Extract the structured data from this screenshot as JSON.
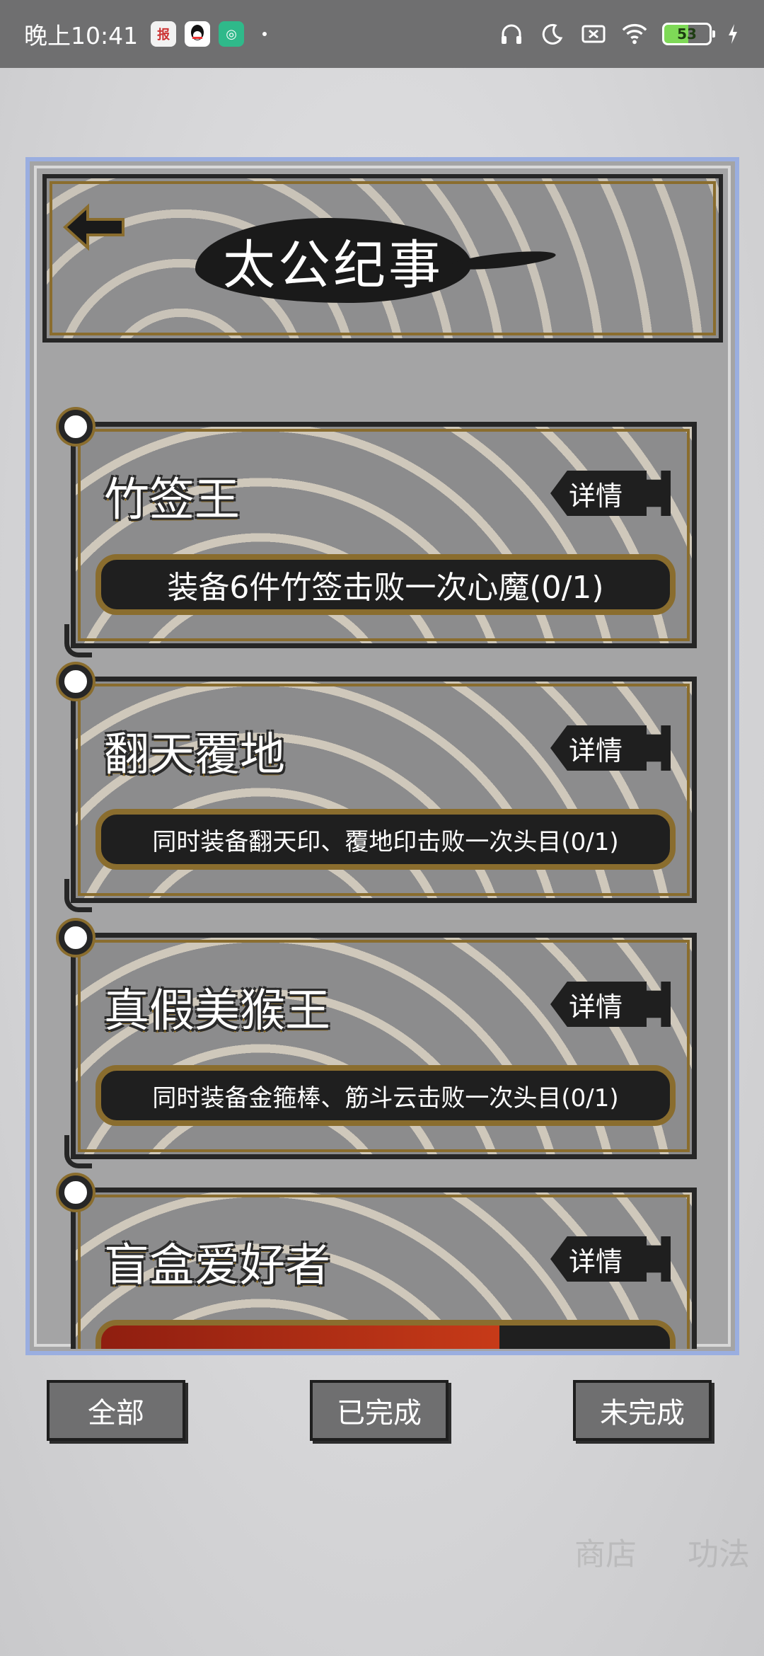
{
  "status_bar": {
    "time": "晚上10:41",
    "battery": "53",
    "apps": [
      "news-app-icon",
      "qq-icon",
      "green-app-icon"
    ]
  },
  "header": {
    "title": "太公纪事"
  },
  "achievements": [
    {
      "name": "竹签王",
      "detail_label": "详情",
      "description": "装备6件竹签击败一次心魔(0/1)"
    },
    {
      "name": "翻天覆地",
      "detail_label": "详情",
      "description": "同时装备翻天印、覆地印击败一次头目(0/1)"
    },
    {
      "name": "真假美猴王",
      "detail_label": "详情",
      "description": "同时装备金箍棒、筋斗云击败一次头目(0/1)"
    },
    {
      "name": "盲盒爱好者",
      "detail_label": "详情",
      "description": ""
    }
  ],
  "tabs": {
    "all": "全部",
    "completed": "已完成",
    "incomplete": "未完成"
  },
  "background": {
    "shop": "商店",
    "skills": "功法"
  },
  "colors": {
    "panel_border": "#9aaee0",
    "gold_trim": "#8a6d2e",
    "dark": "#1f1f1f"
  }
}
